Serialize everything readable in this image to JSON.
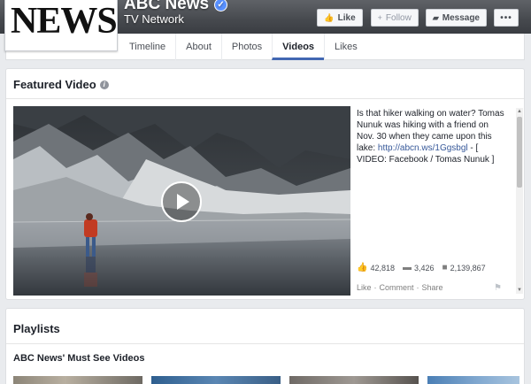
{
  "header": {
    "logo_text": "NEWS",
    "page_name": "ABC News",
    "verified_icon": "verified-check-icon",
    "category": "TV Network",
    "buttons": {
      "like": "Like",
      "follow": "Follow",
      "message": "Message",
      "more": "•••"
    }
  },
  "tabs": [
    {
      "label": "Timeline"
    },
    {
      "label": "About"
    },
    {
      "label": "Photos"
    },
    {
      "label": "Videos",
      "active": true
    },
    {
      "label": "Likes"
    }
  ],
  "featured": {
    "title": "Featured Video",
    "description_text": "Is that hiker walking on water? Tomas Nunuk was hiking with a friend on Nov. 30 when they came upon this lake:",
    "link": "http://abcn.ws/1Ggsbgl",
    "description_tail": " - [ VIDEO: Facebook / Tomas Nunuk ]",
    "stats": {
      "likes": "42,818",
      "comments": "3,426",
      "views": "2,139,867"
    },
    "actions": {
      "like": "Like",
      "sep": "·",
      "comment": "Comment",
      "share": "Share"
    }
  },
  "playlists": {
    "title": "Playlists",
    "subtitle": "ABC News' Must See Videos"
  },
  "colors": {
    "accent": "#4267b2",
    "link": "#365899",
    "background": "#e9ebee"
  }
}
